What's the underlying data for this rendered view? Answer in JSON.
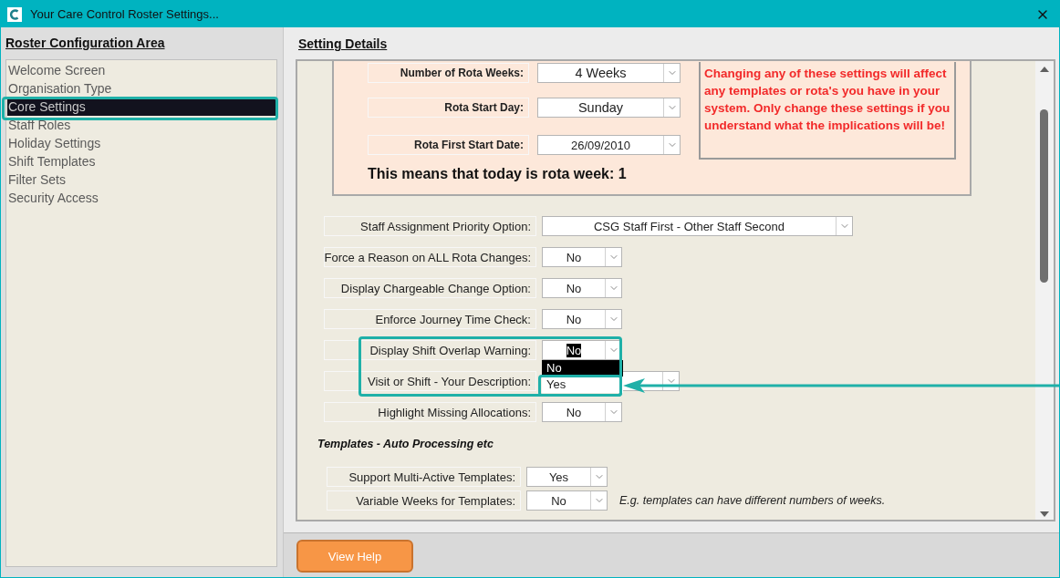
{
  "window": {
    "title": "Your Care Control Roster Settings..."
  },
  "sidebar": {
    "heading": "Roster Configuration Area",
    "items": [
      {
        "label": "Welcome Screen",
        "selected": false
      },
      {
        "label": "Organisation Type",
        "selected": false
      },
      {
        "label": "Core Settings",
        "selected": true
      },
      {
        "label": "Staff Roles",
        "selected": false
      },
      {
        "label": "Holiday Settings",
        "selected": false
      },
      {
        "label": "Shift Templates",
        "selected": false
      },
      {
        "label": "Filter Sets",
        "selected": false
      },
      {
        "label": "Security Access",
        "selected": false
      }
    ]
  },
  "details": {
    "heading": "Setting Details",
    "rota_box": {
      "fields": [
        {
          "label": "Number of Rota Weeks:",
          "value": "4 Weeks"
        },
        {
          "label": "Rota Start Day:",
          "value": "Sunday"
        },
        {
          "label": "Rota First Start Date:",
          "value": "26/09/2010"
        }
      ],
      "summary": "This means that today is rota week:  1",
      "warning": "Changing any of these settings will affect any templates or rota's you have in your system.  Only change these settings if you understand what the implications will be!"
    },
    "settings": [
      {
        "label": "Staff Assignment Priority Option:",
        "value": "CSG Staff First - Other Staff Second",
        "kind": "wide",
        "open": false
      },
      {
        "label": "Force a Reason on ALL Rota Changes:",
        "value": "No",
        "kind": "short",
        "open": false
      },
      {
        "label": "Display Chargeable Change Option:",
        "value": "No",
        "kind": "short",
        "open": false
      },
      {
        "label": "Enforce Journey Time Check:",
        "value": "No",
        "kind": "short",
        "open": false
      },
      {
        "label": "Display Shift Overlap Warning:",
        "value": "No",
        "kind": "short",
        "open": true,
        "options": [
          {
            "label": "No",
            "selected": true
          },
          {
            "label": "Yes",
            "selected": false
          }
        ]
      },
      {
        "label": "Visit or Shift - Your Description:",
        "kind": "medium",
        "open": false
      },
      {
        "label": "Highlight Missing Allocations:",
        "value": "No",
        "kind": "short",
        "open": false
      }
    ],
    "templates": {
      "heading": "Templates - Auto Processing etc",
      "settings": [
        {
          "label": "Support Multi-Active Templates:",
          "value": "Yes"
        },
        {
          "label": "Variable Weeks for Templates:",
          "value": "No",
          "note": "E.g. templates can have different numbers of weeks."
        }
      ]
    }
  },
  "footer": {
    "help_button": "View Help"
  }
}
